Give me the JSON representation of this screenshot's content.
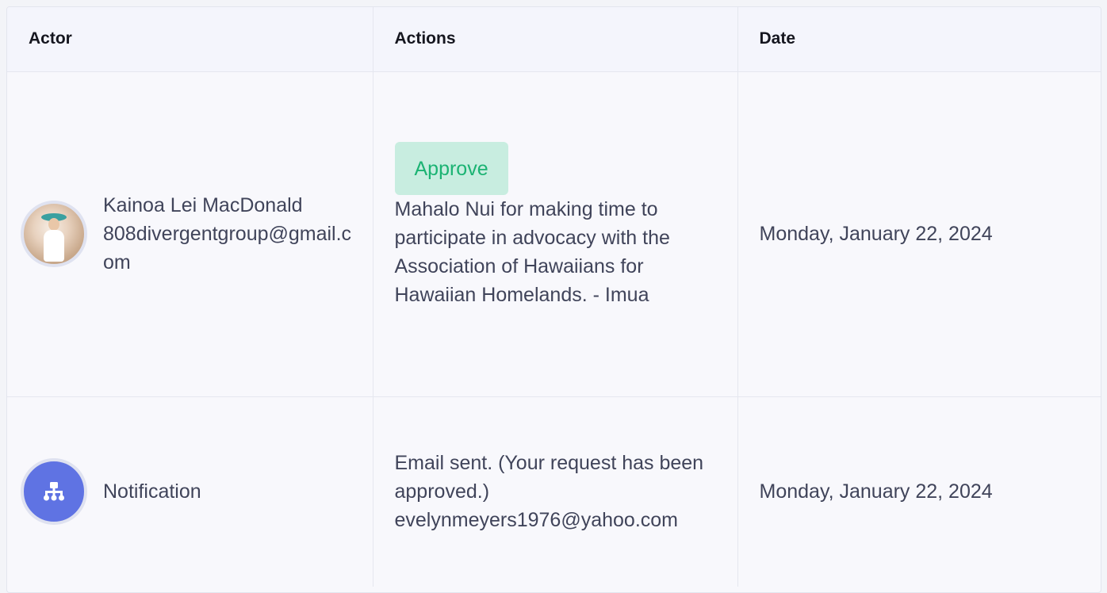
{
  "table": {
    "headers": {
      "actor": "Actor",
      "actions": "Actions",
      "date": "Date"
    },
    "rows": [
      {
        "actor_name": "Kainoa Lei MacDonald",
        "actor_email": "808divergentgroup@gmail.com",
        "avatar": "user-photo",
        "badge": "Approve",
        "action_text": "Mahalo Nui for making time to participate in advocacy with the Association of Hawaiians for Hawaiian Homelands. - Imua",
        "date": "Monday, January 22, 2024"
      },
      {
        "actor_name": "Notification",
        "avatar": "sitemap-icon",
        "action_text": "Email sent. (Your request has been approved.)",
        "action_email": "evelynmeyers1976@yahoo.com",
        "date": "Monday, January 22, 2024"
      }
    ]
  },
  "colors": {
    "approve_bg": "#c8ede0",
    "approve_text": "#1bb373",
    "notification_icon_bg": "#5f73e3"
  }
}
